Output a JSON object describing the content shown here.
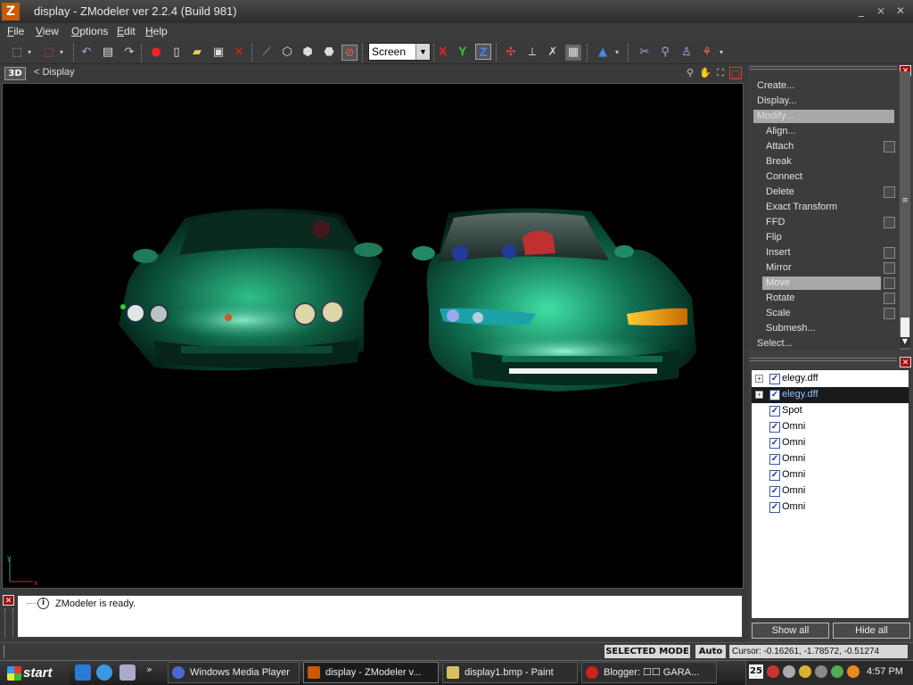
{
  "window": {
    "title": "display - ZModeler ver 2.2.4 (Build 981)",
    "app_icon": "Z"
  },
  "menu": [
    "File",
    "View",
    "Options",
    "Edit",
    "Help"
  ],
  "toolbar": {
    "screen_select": "Screen",
    "axis_x": "X",
    "axis_y": "Y",
    "axis_z": "Z"
  },
  "viewport": {
    "mode_badge": "3D",
    "title": "<  Display"
  },
  "commands": {
    "create": "Create...",
    "display": "Display...",
    "modify": "Modify...",
    "items": [
      {
        "label": "Align...",
        "has_box": false
      },
      {
        "label": "Attach",
        "has_box": true
      },
      {
        "label": "Break",
        "has_box": false
      },
      {
        "label": "Connect",
        "has_box": false
      },
      {
        "label": "Delete",
        "has_box": true
      },
      {
        "label": "Exact Transform",
        "has_box": false
      },
      {
        "label": "FFD",
        "has_box": true
      },
      {
        "label": "Flip",
        "has_box": false
      },
      {
        "label": "Insert",
        "has_box": true
      },
      {
        "label": "Mirror",
        "has_box": true
      },
      {
        "label": "Move",
        "has_box": true
      },
      {
        "label": "Rotate",
        "has_box": true
      },
      {
        "label": "Scale",
        "has_box": true
      },
      {
        "label": "Submesh...",
        "has_box": false
      }
    ],
    "select": "Select..."
  },
  "objects": [
    {
      "name": "elegy.dff",
      "expandable": true,
      "checked": true,
      "selected": false
    },
    {
      "name": "elegy.dff",
      "expandable": true,
      "checked": true,
      "selected": true
    },
    {
      "name": "Spot",
      "expandable": false,
      "checked": true,
      "selected": false
    },
    {
      "name": "Omni",
      "expandable": false,
      "checked": true,
      "selected": false
    },
    {
      "name": "Omni",
      "expandable": false,
      "checked": true,
      "selected": false
    },
    {
      "name": "Omni",
      "expandable": false,
      "checked": true,
      "selected": false
    },
    {
      "name": "Omni",
      "expandable": false,
      "checked": true,
      "selected": false
    },
    {
      "name": "Omni",
      "expandable": false,
      "checked": true,
      "selected": false
    },
    {
      "name": "Omni",
      "expandable": false,
      "checked": true,
      "selected": false
    }
  ],
  "panel_buttons": {
    "show_all": "Show all",
    "hide_all": "Hide all"
  },
  "log": {
    "message": "ZModeler is ready."
  },
  "status": {
    "mode": "SELECTED MODE",
    "auto": "Auto",
    "cursor": "Cursor: -0.16261, -1.78572, -0.51274"
  },
  "taskbar": {
    "start": "start",
    "tasks": [
      "Windows Media Player",
      "display - ZModeler v...",
      "display1.bmp - Paint",
      "Blogger: ☐☐ GARA..."
    ],
    "tray_date": "25",
    "clock": "4:57 PM"
  },
  "axis_gizmo": {
    "y": "y",
    "x": "x"
  }
}
